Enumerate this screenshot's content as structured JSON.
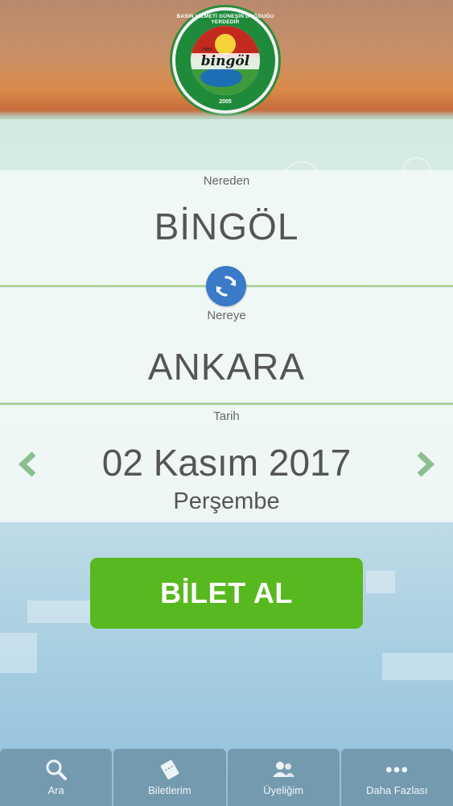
{
  "header": {
    "logo": {
      "arc_text": "BASIN HİZMETİ GÜNEŞİN DOĞDUĞU YERDEDİR",
      "prefix": "Has",
      "name": "bingöl",
      "year": "2005",
      "icon": "bingol-logo"
    }
  },
  "route": {
    "from_label": "Nereden",
    "from_value": "BİNGÖL",
    "swap_icon": "swap-arrows-icon",
    "to_label": "Nereye",
    "to_value": "ANKARA"
  },
  "date": {
    "label": "Tarih",
    "value": "02 Kasım 2017",
    "weekday": "Perşembe",
    "prev_icon": "chevron-left-icon",
    "next_icon": "chevron-right-icon"
  },
  "action": {
    "buy_label": "BİLET AL"
  },
  "nav": {
    "items": [
      {
        "label": "Ara",
        "icon": "search-icon"
      },
      {
        "label": "Biletlerim",
        "icon": "ticket-icon"
      },
      {
        "label": "Üyeliğim",
        "icon": "users-icon"
      },
      {
        "label": "Daha Fazlası",
        "icon": "more-dots-icon"
      }
    ]
  },
  "colors": {
    "accent_green": "#58b81f",
    "swap_blue": "#3b79c9",
    "arrow_green": "#8bbf8f",
    "nav_bg": "#7094aa"
  }
}
